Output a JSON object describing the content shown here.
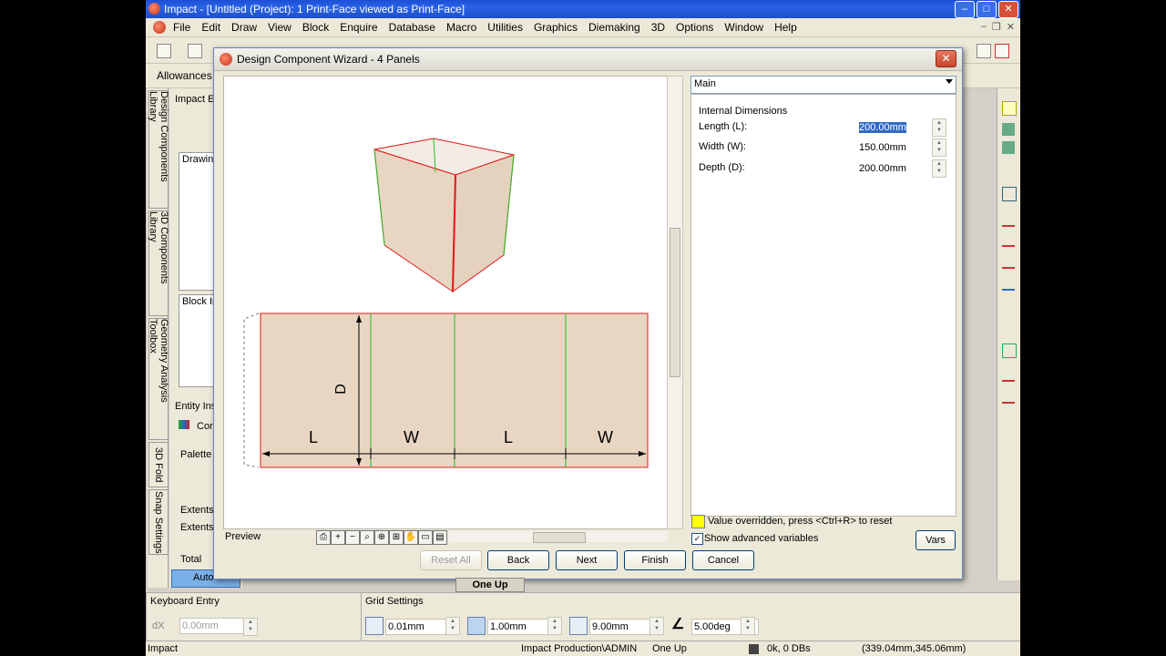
{
  "app": {
    "title": "Impact - [Untitled (Project): 1 Print-Face viewed as  Print-Face]",
    "menus": [
      "File",
      "Edit",
      "Draw",
      "View",
      "Block",
      "Enquire",
      "Database",
      "Macro",
      "Utilities",
      "Graphics",
      "Diemaking",
      "3D",
      "Options",
      "Window",
      "Help"
    ],
    "allowances_label": "Allowances"
  },
  "vtabs": [
    "Design Components Library",
    "3D Components Library",
    "Geometry Analysis Toolbox",
    "3D Fold",
    "Snap Settings"
  ],
  "left_panel": {
    "impact_label": "Impact E",
    "drawing_label": "Drawin",
    "block_label": "Block In",
    "entity_label": "Entity Ins",
    "palette_label": "Palette",
    "extents1": "Extents",
    "extents2": "Extents",
    "total_label": "Total",
    "auto_label": "Auto",
    "comp_label": "Cor"
  },
  "dialog": {
    "title": "Design Component Wizard - 4 Panels",
    "preview_label": "Preview",
    "section_select": "Main",
    "group_label": "Internal Dimensions",
    "fields": [
      {
        "label": "Length (L):",
        "value": "200.00mm",
        "selected": true
      },
      {
        "label": "Width (W):",
        "value": "150.00mm",
        "selected": false
      },
      {
        "label": "Depth (D):",
        "value": "200.00mm",
        "selected": false
      }
    ],
    "legend_text": "Value overridden, press <Ctrl+R> to reset",
    "legend_color": "#ffff00",
    "show_advanced": "Show advanced variables",
    "show_advanced_checked": true,
    "vars_button": "Vars",
    "buttons": {
      "reset_all": "Reset All",
      "back": "Back",
      "next": "Next",
      "finish": "Finish",
      "cancel": "Cancel"
    }
  },
  "drawing": {
    "panel_labels": [
      "L",
      "W",
      "L",
      "W"
    ],
    "depth_label": "D",
    "fill_color": "#e8d6c2",
    "cut_color": "#e01818",
    "crease_color": "#20c020"
  },
  "keyboard_entry": {
    "title": "Keyboard Entry",
    "dx_label": "dX",
    "dx_value": "0.00mm"
  },
  "grid_settings": {
    "title": "Grid Settings",
    "values": [
      "0.01mm",
      "1.00mm",
      "9.00mm",
      "5.00deg"
    ]
  },
  "status": {
    "app": "Impact",
    "user": "Impact Production\\ADMIN",
    "layout": "One Up",
    "disk": "0k, 0 DBs",
    "coords": "(339.04mm,345.06mm)",
    "one_up_tab": "One Up"
  }
}
